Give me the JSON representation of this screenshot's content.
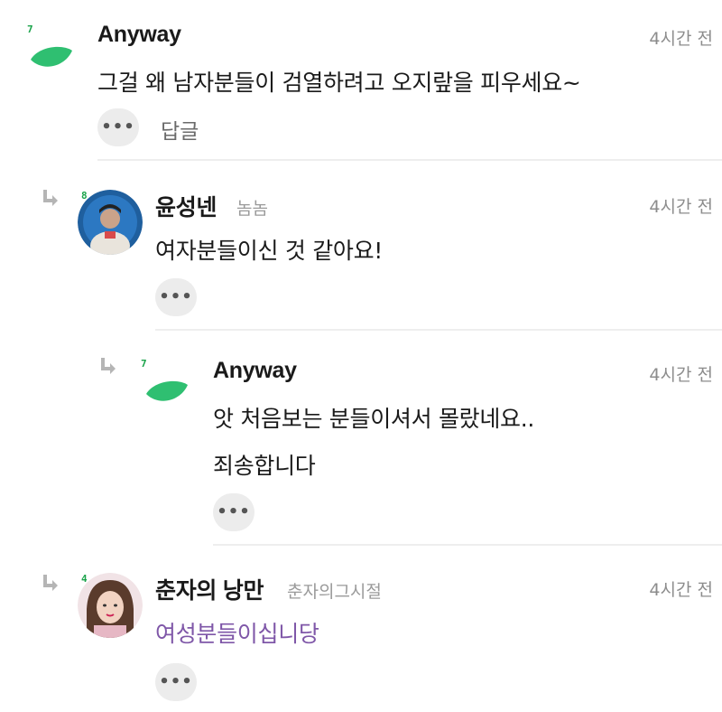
{
  "comments": [
    {
      "level": "7",
      "author": "Anyway",
      "time": "4시간 전",
      "lines": [
        "그걸 왜 남자분들이 검열하려고 오지랖을 피우세요~"
      ],
      "reply_label": "답글"
    },
    {
      "level": "8",
      "author": "윤성넨",
      "nickname": "놈놈",
      "time": "4시간 전",
      "lines": [
        "여자분들이신 것 같아요!"
      ]
    },
    {
      "level": "7",
      "author": "Anyway",
      "time": "4시간 전",
      "lines": [
        "앗 처음보는 분들이셔서 몰랐네요..",
        "죄송합니다"
      ]
    },
    {
      "level": "4",
      "author": "춘자의 낭만",
      "nickname": "춘자의그시절",
      "time": "4시간 전",
      "lines": [
        "여성분들이십니당"
      ],
      "text_color": "#7f57a8"
    }
  ],
  "more_label": "•••",
  "icons": {
    "reply_arrow": "reply-arrow-icon",
    "leaf": "leaf-icon",
    "more": "more-options-icon"
  },
  "colors": {
    "leaf": "#2fbf71",
    "level": "#1aa34a",
    "highlight_text": "#7f57a8"
  }
}
